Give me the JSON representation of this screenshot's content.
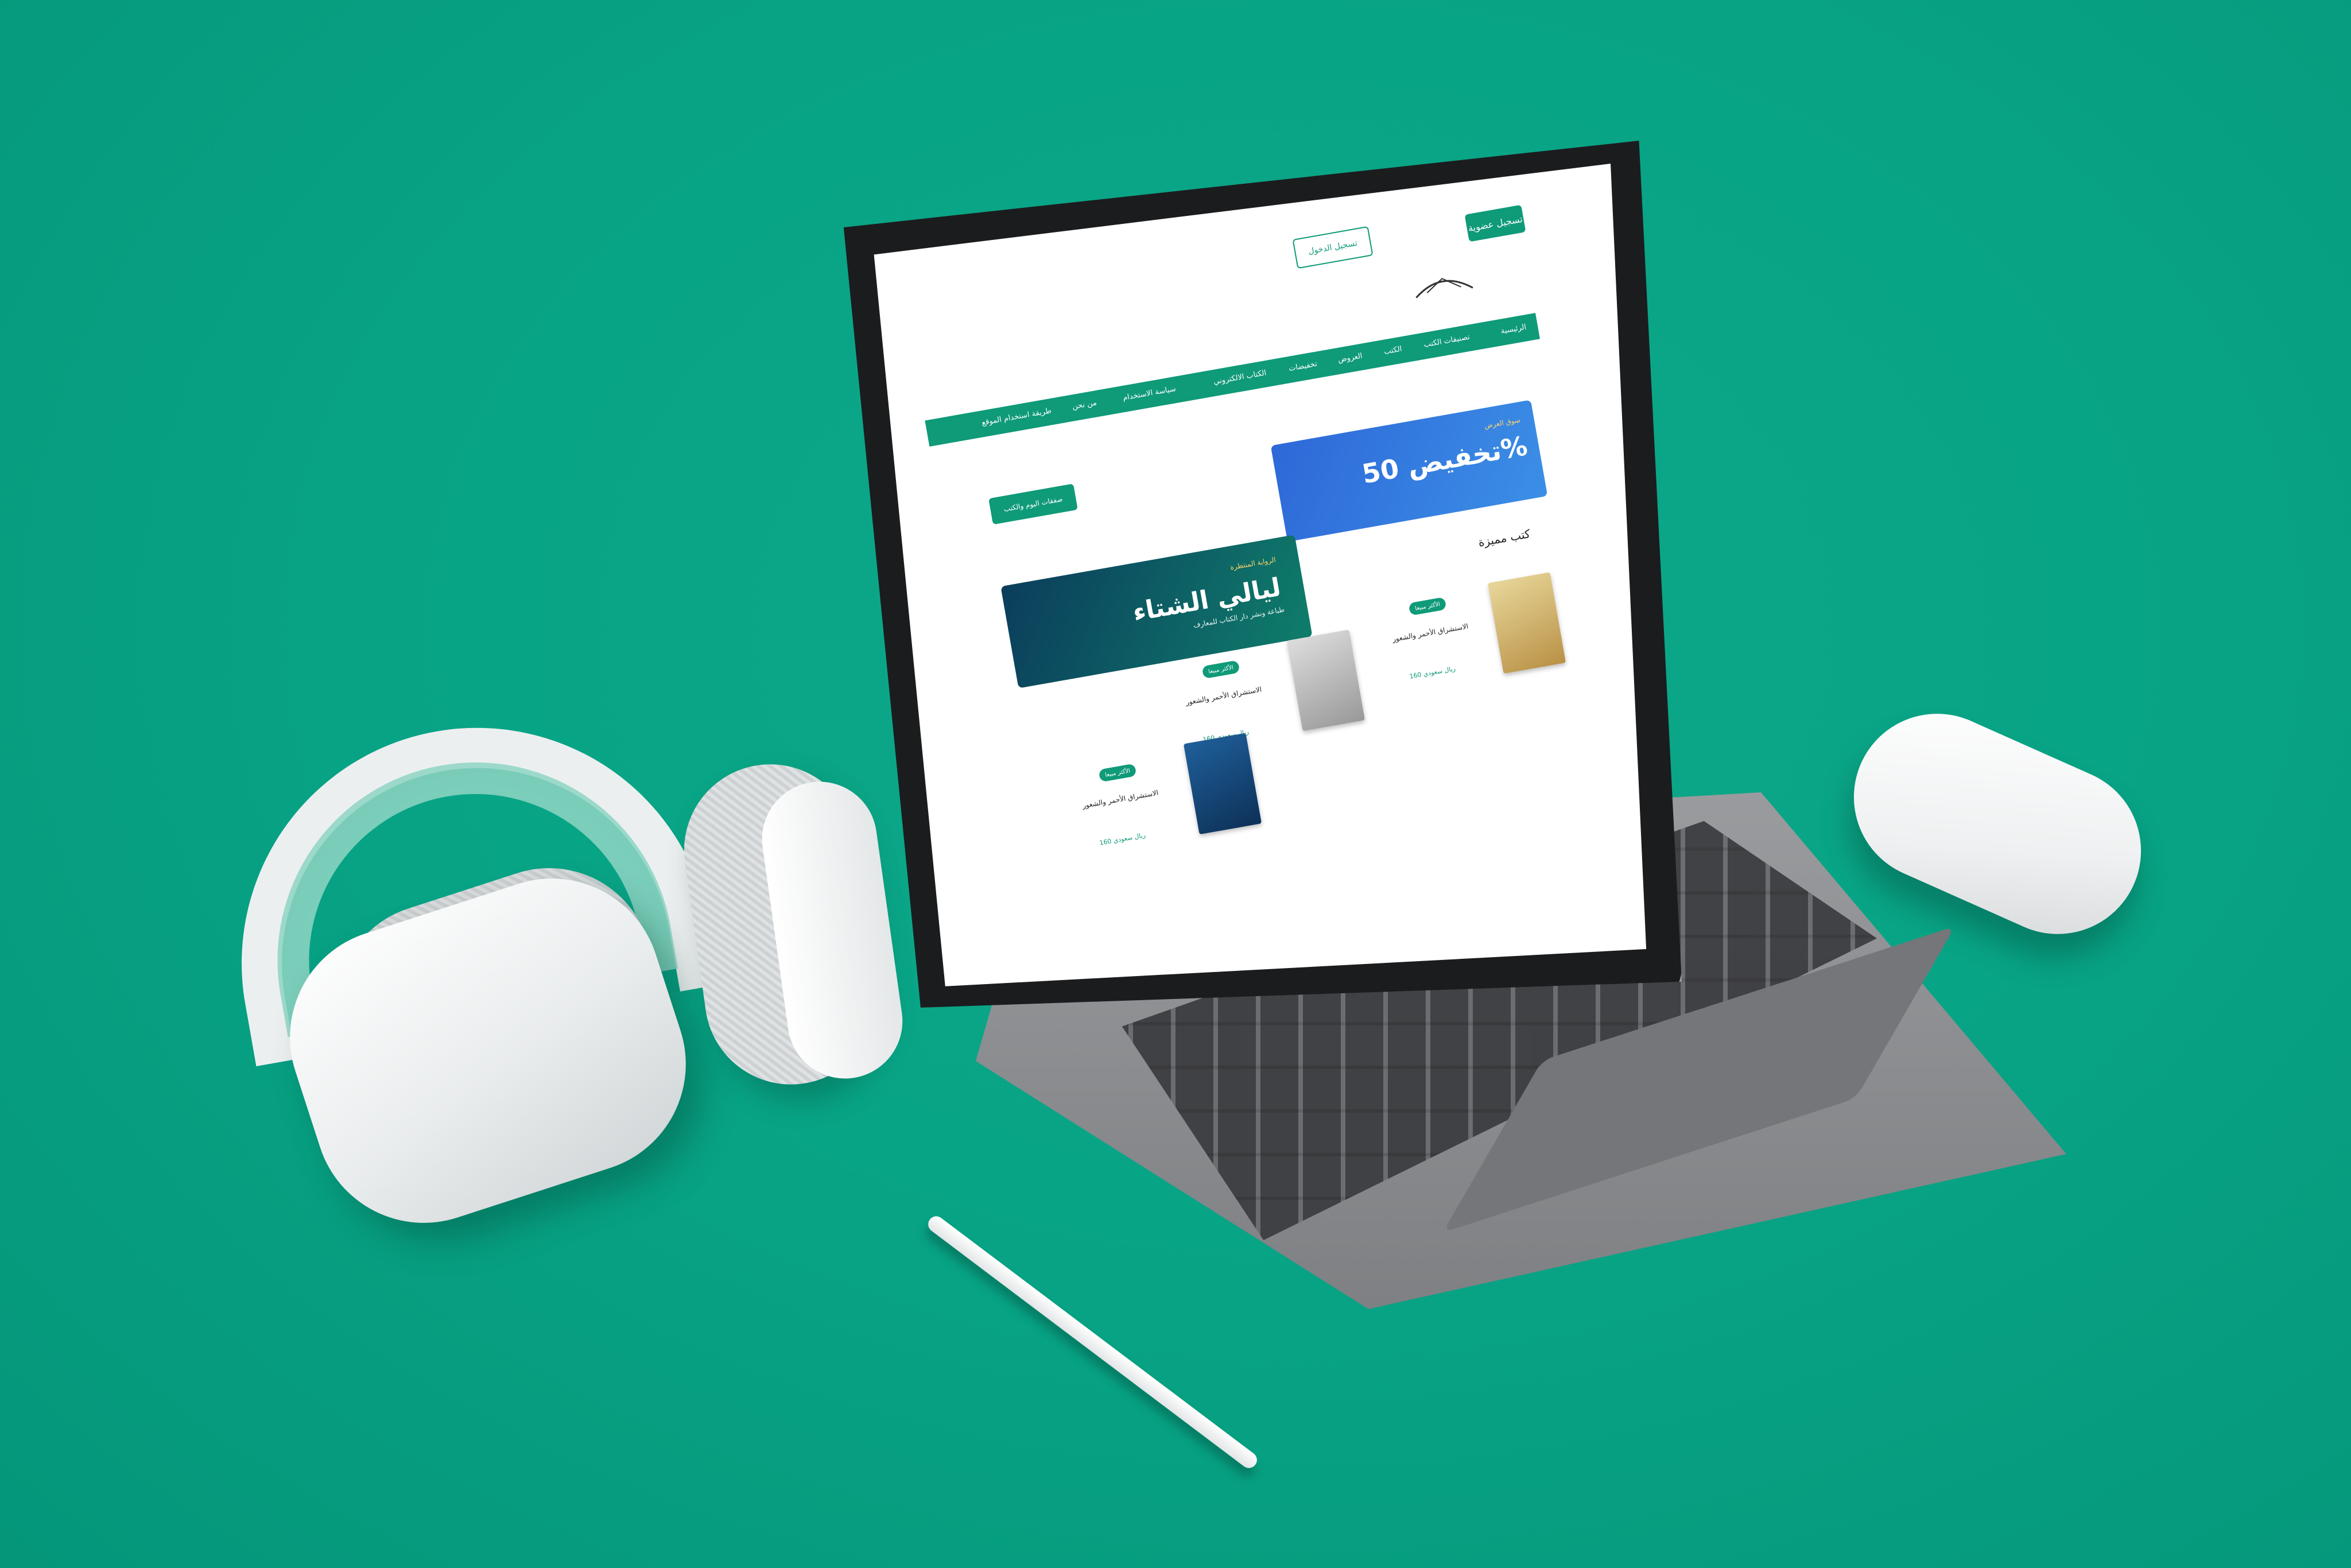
{
  "screen": {
    "header": {
      "signup_label": "تسجيل عضوية",
      "login_label": "تسجيل الدخول"
    },
    "nav": {
      "items": [
        "الرئيسية",
        "تصنيفات الكتب",
        "الكتب",
        "العروض",
        "تخفيضات",
        "الكتاب الالكتروني",
        "سياسة الاستخدام",
        "من نحن",
        "طريقة استخدام الموقع"
      ]
    },
    "banners": {
      "offer_main": "تخفيض 50%",
      "offer_sub": "سوق العرض",
      "nights_main": "ليالي الشتاء",
      "nights_sub": "الرواية المنتظرة",
      "nights_sub2": "طباعة ونشر دار الكتاب للمعارف"
    },
    "deals_button": "صفقات اليوم والكتب",
    "featured_title": "كتب مميزة",
    "books": [
      {
        "badge": "الأكثر مبيعا",
        "title": "الاستشراق الأحمر والشعور",
        "price": "160 ريال سعودي"
      },
      {
        "badge": "الأكثر مبيعا",
        "title": "الاستشراق الأحمر والشعور",
        "price": "160 ريال سعودي"
      },
      {
        "badge": "الأكثر مبيعا",
        "title": "الاستشراق الأحمر والشعور",
        "price": "160 ريال سعودي"
      }
    ]
  },
  "colors": {
    "background": "#08a486",
    "accent": "#0f9a78",
    "offer_blue": "#2e68d8"
  },
  "icons": [
    "headphones-icon",
    "mouse-icon",
    "pencil-icon",
    "keyboard-icon",
    "tablet-icon"
  ]
}
